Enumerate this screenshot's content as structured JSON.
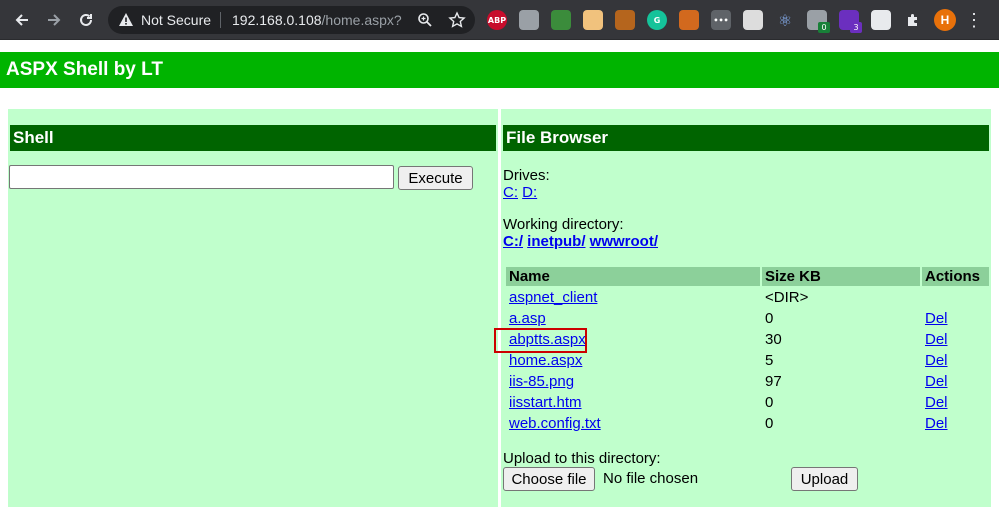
{
  "browser": {
    "security_label": "Not Secure",
    "url_host": "192.168.0.108",
    "url_path": "/home.aspx?",
    "extensions": [
      {
        "name": "abp-icon",
        "text": "ABP",
        "color": "#c70d2c"
      },
      {
        "name": "extension-cloud-icon",
        "text": "",
        "color": "#9aa0a6"
      },
      {
        "name": "shield-icon",
        "text": "",
        "color": "#3b8c3b"
      },
      {
        "name": "face-icon",
        "text": "",
        "color": "#f1c27d"
      },
      {
        "name": "cookie-icon",
        "text": "",
        "color": "#b5651d"
      },
      {
        "name": "grammarly-icon",
        "text": "G",
        "color": "#15c39a"
      },
      {
        "name": "cookie-editor-icon",
        "text": "",
        "color": "#d2691e"
      },
      {
        "name": "dots-icon",
        "text": "•••",
        "color": "#5f6368"
      },
      {
        "name": "tag-icon",
        "text": "",
        "color": "#dddddd"
      },
      {
        "name": "react-icon",
        "text": "⚛",
        "color": "#35363a"
      },
      {
        "name": "wappalyzer-icon",
        "text": "",
        "color": "#9aa0a6"
      },
      {
        "name": "hexagon-icon",
        "text": "",
        "color": "#6b2fbf"
      },
      {
        "name": "camera-icon",
        "text": "",
        "color": "#e8eaed"
      },
      {
        "name": "puzzle-icon",
        "text": "",
        "color": "#35363a"
      }
    ],
    "badge_counts": [
      "0",
      "3"
    ],
    "avatar_letter": "H",
    "menu_glyph": "⋮"
  },
  "page": {
    "title": "ASPX Shell by LT",
    "shell": {
      "heading": "Shell",
      "command_value": "",
      "execute_label": "Execute"
    },
    "file_browser": {
      "heading": "File Browser",
      "drives_label": "Drives:",
      "drives": [
        "C:",
        "D:"
      ],
      "working_dir_label": "Working directory:",
      "path_parts": [
        "C:/",
        "inetpub/",
        "wwwroot/"
      ],
      "columns": [
        "Name",
        "Size KB",
        "Actions"
      ],
      "rows": [
        {
          "name": "aspnet_client",
          "size": "<DIR>",
          "action": ""
        },
        {
          "name": "a.asp",
          "size": "0",
          "action": "Del"
        },
        {
          "name": "abptts.aspx",
          "size": "30",
          "action": "Del"
        },
        {
          "name": "home.aspx",
          "size": "5",
          "action": "Del"
        },
        {
          "name": "iis-85.png",
          "size": "97",
          "action": "Del"
        },
        {
          "name": "iisstart.htm",
          "size": "0",
          "action": "Del"
        },
        {
          "name": "web.config.txt",
          "size": "0",
          "action": "Del"
        }
      ],
      "upload_label": "Upload to this directory:",
      "choose_file_label": "Choose file",
      "no_file_label": "No file chosen",
      "upload_button_label": "Upload"
    }
  },
  "colors": {
    "banner": "#00b400",
    "panel_header": "#006400",
    "panel_bg": "#c0ffcc",
    "table_header": "#8cd09a",
    "highlight": "#cc0000"
  }
}
